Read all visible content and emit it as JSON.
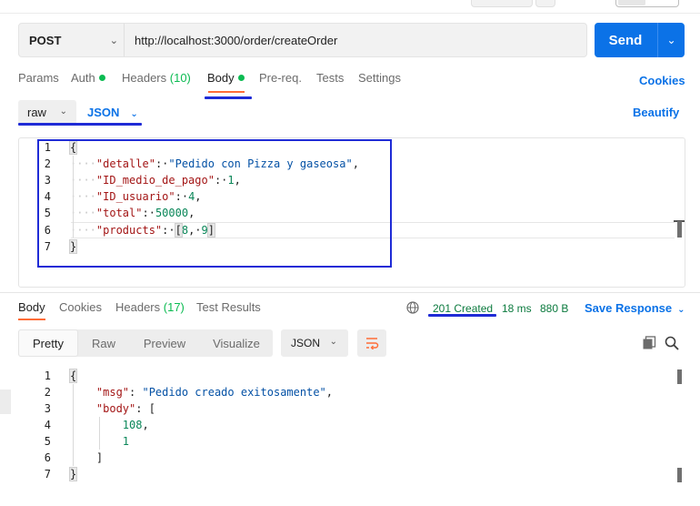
{
  "request": {
    "method": "POST",
    "url": "http://localhost:3000/order/createOrder",
    "send_label": "Send",
    "tabs": [
      {
        "label": "Params",
        "count": ""
      },
      {
        "label": "Auth",
        "count": ""
      },
      {
        "label": "Headers",
        "count": "(10)"
      },
      {
        "label": "Body",
        "count": ""
      },
      {
        "label": "Pre-req.",
        "count": ""
      },
      {
        "label": "Tests",
        "count": ""
      },
      {
        "label": "Settings",
        "count": ""
      }
    ],
    "active_tab": "Body",
    "cookies_label": "Cookies",
    "body_mode": "raw",
    "body_format": "JSON",
    "beautify_label": "Beautify",
    "body_lines": [
      {
        "n": "1",
        "text": "{"
      },
      {
        "n": "2",
        "key": "\"detalle\"",
        "value": "\"Pedido con Pizza y gaseosa\""
      },
      {
        "n": "3",
        "key": "\"ID_medio_de_pago\"",
        "value": "1"
      },
      {
        "n": "4",
        "key": "\"ID_usuario\"",
        "value": "4"
      },
      {
        "n": "5",
        "key": "\"total\"",
        "value": "50000"
      },
      {
        "n": "6",
        "key": "\"products\"",
        "value_a": "8",
        "value_b": "9"
      },
      {
        "n": "7",
        "text": "}"
      }
    ]
  },
  "response": {
    "tabs": [
      {
        "label": "Body",
        "count": ""
      },
      {
        "label": "Cookies",
        "count": ""
      },
      {
        "label": "Headers",
        "count": "(17)"
      },
      {
        "label": "Test Results",
        "count": ""
      }
    ],
    "status": "201 Created",
    "time": "18 ms",
    "size": "880 B",
    "save_label": "Save Response",
    "view_modes": [
      "Pretty",
      "Raw",
      "Preview",
      "Visualize"
    ],
    "active_view": "Pretty",
    "format": "JSON",
    "body_lines": [
      {
        "n": "1",
        "text": "{"
      },
      {
        "n": "2",
        "key": "\"msg\"",
        "value": "\"Pedido creado exitosamente\""
      },
      {
        "n": "3",
        "key": "\"body\"",
        "text": "["
      },
      {
        "n": "4",
        "value": "108"
      },
      {
        "n": "5",
        "value": "1"
      },
      {
        "n": "6",
        "text": "]"
      },
      {
        "n": "7",
        "text": "}"
      }
    ]
  },
  "colors": {
    "accent": "#0b72e7",
    "orange": "#ff6c37",
    "green": "#0cbb52",
    "annotation_blue": "#1f2bd6"
  }
}
